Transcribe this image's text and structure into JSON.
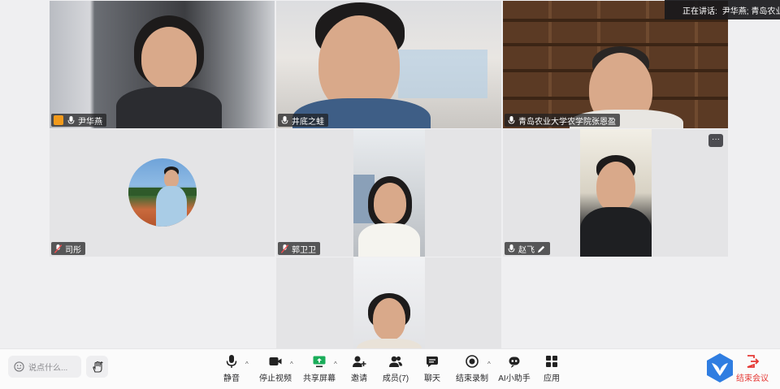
{
  "speaker": {
    "label": "正在讲话:",
    "names": "尹华燕; 青岛农业"
  },
  "tiles": [
    {
      "name": "尹华燕",
      "host": true
    },
    {
      "name": "井底之蛙"
    },
    {
      "name": "青岛农业大学农学院张恩盈"
    },
    {
      "name": "司彤"
    },
    {
      "name": "郭卫卫"
    },
    {
      "name": "赵飞",
      "more": "···"
    },
    {
      "name": ""
    }
  ],
  "chat": {
    "placeholder": "说点什么..."
  },
  "toolbar": {
    "mute": "静音",
    "stop_video": "停止视频",
    "share_screen": "共享屏幕",
    "invite": "邀请",
    "members": "成员(7)",
    "chat": "聊天",
    "end_recording": "结束录制",
    "ai_assistant": "AI小助手",
    "apps": "应用",
    "end_meeting": "结束会议"
  },
  "colors": {
    "accent_active": "#2fb07a",
    "end_red": "#e53935",
    "share_green": "#1aad5a",
    "host_orange": "#f29a1b"
  }
}
